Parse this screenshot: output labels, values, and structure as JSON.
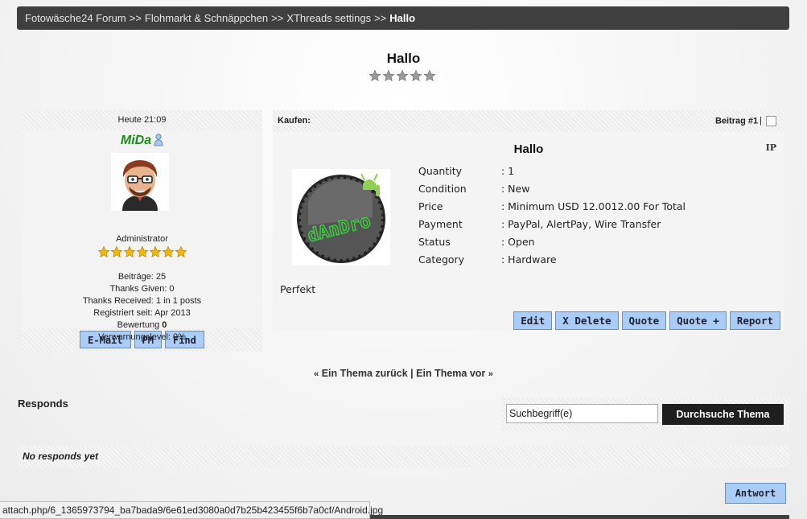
{
  "breadcrumb": {
    "items": [
      "Fotowäsche24 Forum",
      "Flohmarkt & Schnäppchen",
      "XThreads settings"
    ],
    "separator": ">>",
    "current": "Hallo"
  },
  "thread": {
    "title": "Hallo",
    "rating": {
      "value": 0,
      "max": 5
    }
  },
  "user": {
    "date": "Heute 21:09",
    "name": "MiDa",
    "role": "Administrator",
    "rank_stars": 7,
    "stats": [
      "Beiträge: 25",
      "Thanks Given: 0",
      "Thanks Received: 1 in 1 posts",
      "Registriert seit: Apr 2013"
    ],
    "bewertung_label": "Bewertung",
    "bewertung_value": "0",
    "warn": "Verwarnungslevel: 0%",
    "buttons": {
      "email": "E-Mail",
      "pm": "PM",
      "find": "Find"
    }
  },
  "post": {
    "category_label": "Kaufen:",
    "number": "Beitrag #1",
    "title": "Hallo",
    "ip": "IP",
    "image_text": "dAnDro",
    "details": [
      {
        "key": "Quantity",
        "value": ": 1"
      },
      {
        "key": "Condition",
        "value": ": New"
      },
      {
        "key": "Price",
        "value": ": Minimum USD 12.0012.00 For Total"
      },
      {
        "key": "Payment",
        "value": ": PayPal, AlertPay, Wire Transfer"
      },
      {
        "key": "Status",
        "value": ": Open"
      },
      {
        "key": "Category",
        "value": ": Hardware"
      }
    ],
    "text": "Perfekt",
    "buttons": {
      "edit": "Edit",
      "delete": "X Delete",
      "quote": "Quote",
      "quote_plus": "Quote +",
      "report": "Report"
    }
  },
  "nav": {
    "prev": "Ein Thema zurück",
    "divider": "|",
    "next": "Ein Thema vor"
  },
  "responds": {
    "heading": "Responds",
    "search_value": "Suchbegriff(e)",
    "search_button": "Durchsuche Thema",
    "empty": "No responds yet",
    "reply_button": "Antwort"
  },
  "status_bar": {
    "url": "attach.php/6_1365973794_ba7bada9/6e61ed3080a0d7b25b423455f6b7a0cf/Android.jpg"
  },
  "colors": {
    "button_blue": "#a9cdf7",
    "username_green": "#1a8c1a",
    "dark_bar": "#3f3f3f",
    "star_gold": "#f2b705"
  }
}
